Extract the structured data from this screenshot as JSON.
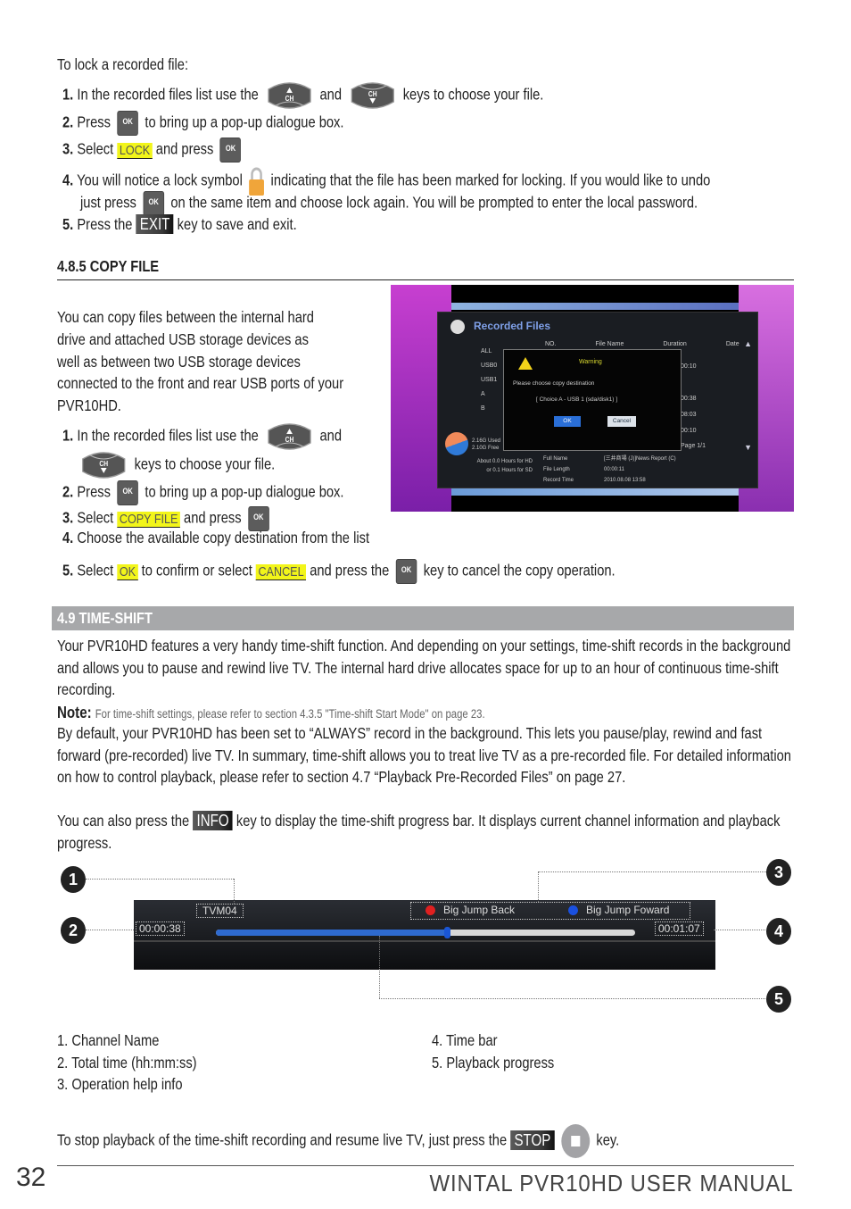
{
  "lock_section": {
    "intro": "To lock a recorded file:",
    "steps": [
      {
        "num": "1.",
        "pre": "In the recorded files list use the",
        "mid": "and",
        "post": "keys to choose your file."
      },
      {
        "num": "2.",
        "pre": "Press",
        "post": "to bring up a pop-up dialogue box."
      },
      {
        "num": "3.",
        "pre": "Select",
        "highlight": "LOCK",
        "post": "and press"
      },
      {
        "num": "4.",
        "pre": "You will notice a lock symbol",
        "post": "indicating that the file has been marked for locking. If you would like to undo",
        "line2_pre": "just press",
        "line2_post": "on the same item and choose lock again. You will be prompted to enter the local password."
      },
      {
        "num": "5.",
        "pre": "Press the",
        "key": "EXIT",
        "post": "key to save and exit."
      }
    ]
  },
  "keys": {
    "ch": "CH",
    "ok": "OK"
  },
  "copy_section": {
    "heading": "4.8.5 COPY FILE",
    "intro_lines": [
      "You can copy files between the internal hard",
      "drive and attached USB storage devices as",
      "well as between two USB storage devices",
      "connected to the front and rear USB ports of your",
      "PVR10HD."
    ],
    "steps": [
      {
        "num": "1.",
        "pre": "In the recorded files list use the",
        "mid": "and",
        "post": "keys to choose your file."
      },
      {
        "num": "2.",
        "pre": "Press",
        "post": "to bring up a pop-up dialogue box."
      },
      {
        "num": "3.",
        "pre": "Select",
        "highlight": "COPY FILE",
        "post": "and press"
      },
      {
        "num": "4.",
        "text": "Choose the available copy destination from the list"
      },
      {
        "num": "5.",
        "pre": "Select",
        "highlight1": "OK",
        "mid": "to confirm or select",
        "highlight2": "CANCEL",
        "mid2": "and press the",
        "post": "key to cancel the copy operation."
      }
    ],
    "screenshot": {
      "title": "Recorded Files",
      "sidebar": [
        "ALL",
        "USB0",
        "USB1",
        "A",
        "B"
      ],
      "columns": [
        "NO.",
        "File Name",
        "Duration",
        "Date"
      ],
      "durations": [
        "00:10",
        "",
        "00:38",
        "08:03",
        "00:10"
      ],
      "page": "Page 1/1",
      "dialog": {
        "title": "Warning",
        "message": "Please choose copy destination",
        "choice": "[ Choice A - USB 1 (sda/disk1) ]",
        "ok": "OK",
        "cancel": "Cancel"
      },
      "storage": [
        "2.16G Used",
        "2.10G Free"
      ],
      "hours": [
        "About 0.0 Hours for HD",
        "or 0.1 Hours for SD"
      ],
      "details": [
        {
          "label": "Full Name",
          "value": "[三井商場 (J)]News Report (C)"
        },
        {
          "label": "File Length",
          "value": "00:00:11"
        },
        {
          "label": "Record Time",
          "value": "2010.08.08 13:58"
        }
      ]
    }
  },
  "timeshift_section": {
    "heading": "4.9 TIME-SHIFT",
    "para1": "Your PVR10HD features a very handy time-shift function. And depending on your settings, time-shift records in the background and allows you to pause and rewind live TV. The internal hard drive allocates space for up to an hour of continuous time-shift recording.",
    "note_label": "Note:",
    "note_text": "For time-shift settings, please refer to section 4.3.5 \"Time-shift Start Mode\" on page 23.",
    "para2": "By default, your PVR10HD has been set to “ALWAYS” record in the background. This lets you pause/play, rewind and fast forward (pre-recorded) live TV. In summary, time-shift allows you to treat live TV as a pre-recorded file. For detailed information on how to control playback, please refer to section 4.7 “Playback Pre-Recorded Files” on page 27.",
    "para3_pre": "You can also press the",
    "para3_key": "INFO",
    "para3_post": "key to display the time-shift progress bar. It displays current channel information and playback progress.",
    "bar": {
      "channel": "TVM04",
      "current_time": "00:00:38",
      "total_time": "00:01:07",
      "help_red": "Big Jump Back",
      "help_blue": "Big Jump Foward",
      "progress": 0.55
    },
    "callouts": [
      "1",
      "2",
      "3",
      "4",
      "5"
    ],
    "legend_left": [
      "1. Channel Name",
      "2. Total time (hh:mm:ss)",
      "3. Operation help info"
    ],
    "legend_right": [
      "4. Time bar",
      "5. Playback progress"
    ],
    "stop_pre": "To stop playback of the time-shift recording and resume live TV, just press the",
    "stop_key": "STOP",
    "stop_post": "key."
  },
  "footer": {
    "page_number": "32",
    "title": "WINTAL PVR10HD USER MANUAL"
  },
  "colors": {
    "highlight": "#f2f51a",
    "section_bar": "#a7a8aa",
    "key_dark": "#4a4a4a",
    "lock": "#f0a53a"
  }
}
